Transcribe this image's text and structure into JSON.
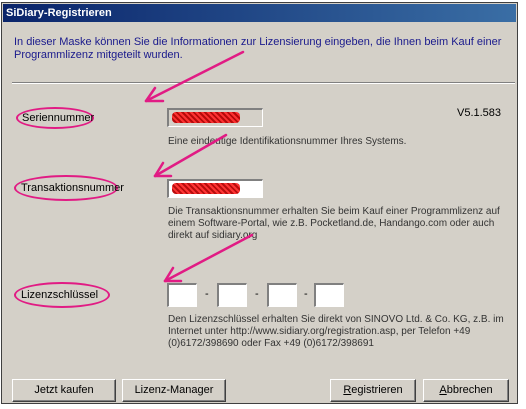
{
  "window": {
    "title": "SiDiary-Registrieren"
  },
  "intro": {
    "text": "In dieser Maske können Sie die Informationen zur Lizensierung eingeben, die Ihnen beim Kauf einer Programmlizenz mitgeteilt wurden."
  },
  "version": "V5.1.583",
  "serial": {
    "label": "Seriennummer",
    "hint": "Eine eindeutige Identifikationsnummer Ihres Systems."
  },
  "transaction": {
    "label": "Transaktionsnummer",
    "hint": "Die Transaktionsnummer erhalten Sie beim Kauf einer Programmlizenz auf einem Software-Portal, wie z.B. Pocketland.de, Handango.com oder auch direkt auf sidiary.org"
  },
  "license": {
    "label": "Lizenzschlüssel",
    "separator": "-",
    "hint": "Den Lizenzschlüssel erhalten Sie direkt von SINOVO Ltd. & Co. KG, z.B. im Internet unter http://www.sidiary.org/registration.asp, per Telefon +49 (0)6172/398690 oder Fax +49 (0)6172/398691",
    "parts": [
      "",
      "",
      "",
      ""
    ]
  },
  "buttons": {
    "buy": "Jetzt kaufen",
    "license_manager": "Lizenz-Manager",
    "register_pre": "",
    "register_ul": "R",
    "register_post": "egistrieren",
    "cancel_pre": "",
    "cancel_ul": "A",
    "cancel_post": "bbrechen"
  },
  "colors": {
    "annotation": "#e11b84",
    "titlebar": "#0a246a",
    "dialog": "#d4d0c8"
  }
}
